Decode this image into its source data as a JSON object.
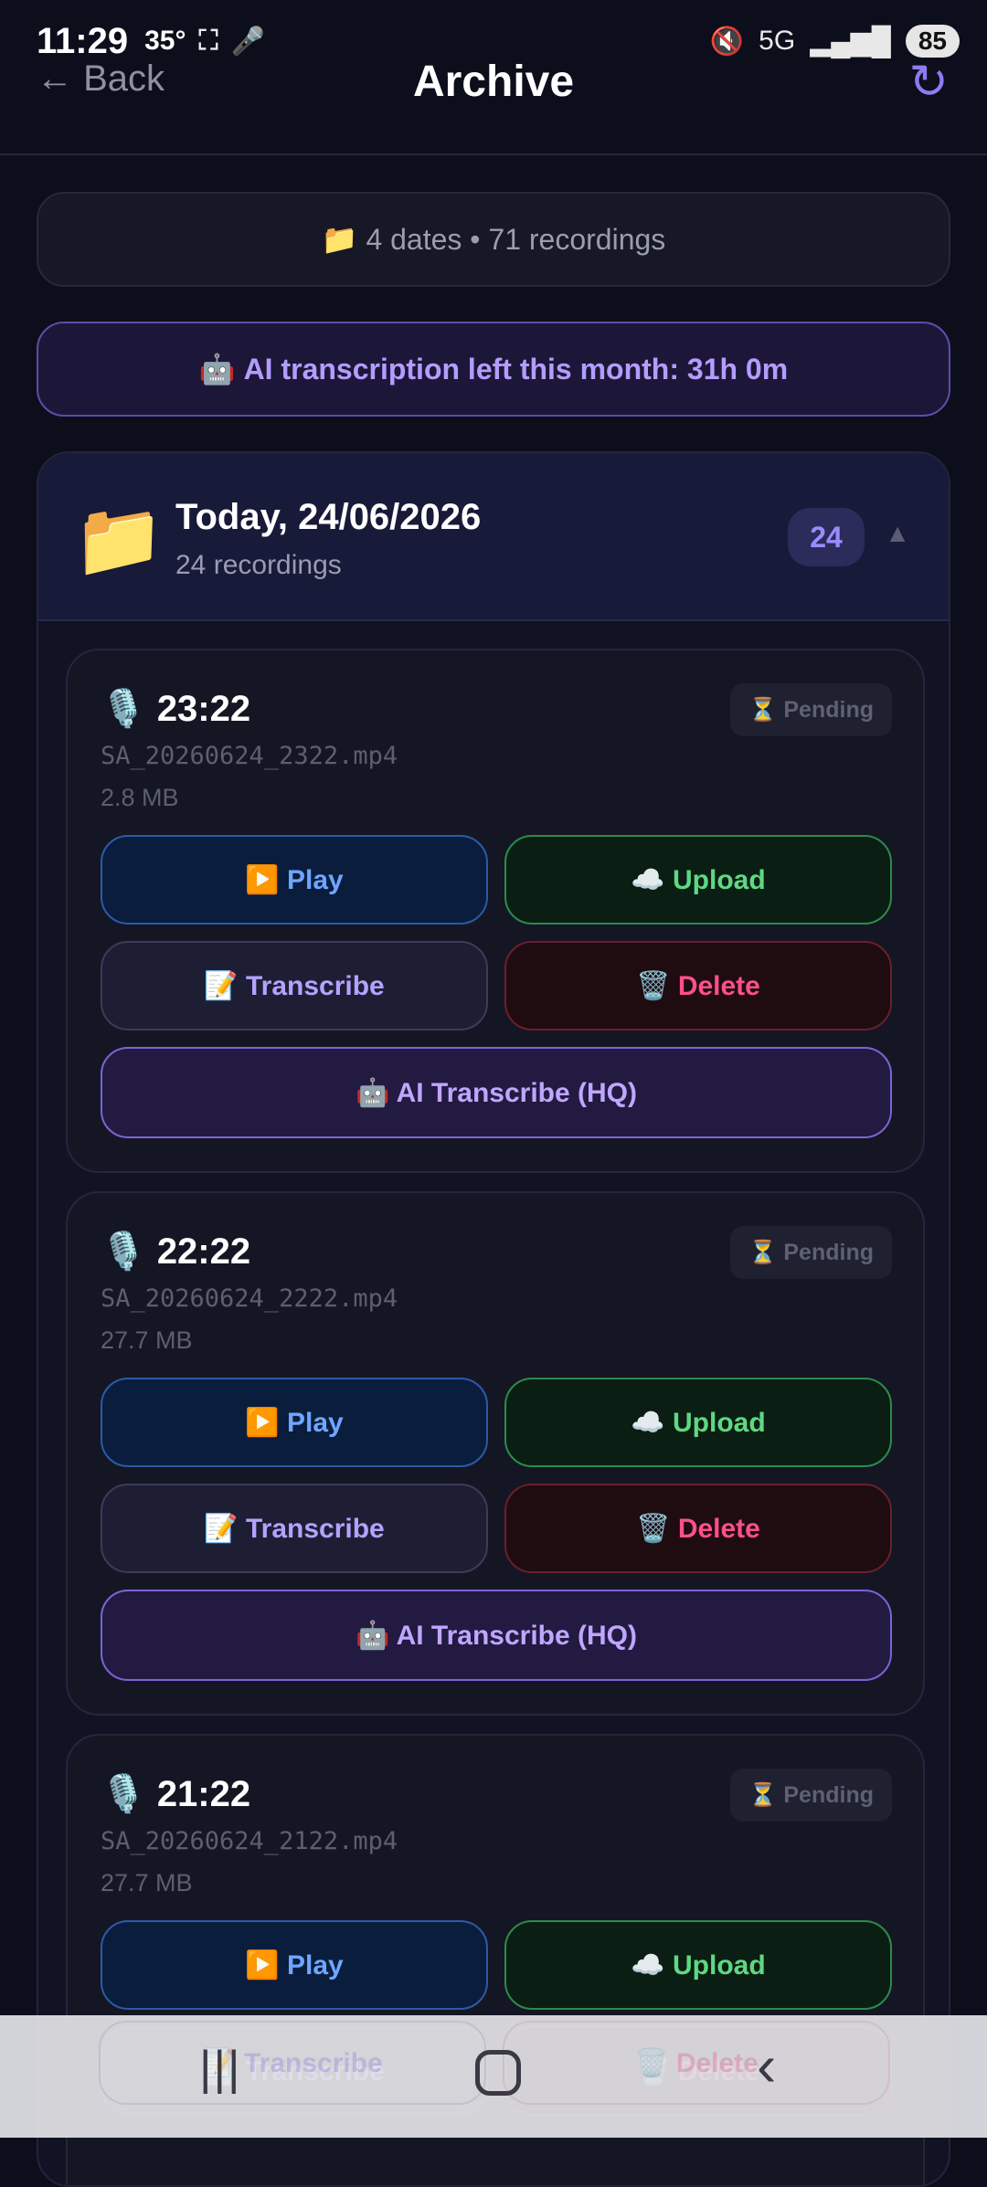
{
  "status_bar": {
    "time": "11:29",
    "temp": "35°",
    "battery": "85"
  },
  "header": {
    "back_label": "← Back",
    "title": "Archive",
    "refresh_glyph": "↻"
  },
  "summary": {
    "icon": "📁",
    "text": "4 dates • 71 recordings"
  },
  "ai_quota": {
    "icon": "🤖",
    "text": "AI transcription left this month: 31h 0m"
  },
  "group": {
    "icon": "📁",
    "title": "Today, 24/06/2026",
    "subtitle": "24 recordings",
    "count": "24",
    "collapse_glyph": "▲"
  },
  "cards": [
    {
      "time": "23:22",
      "file": "SA_20260624_2322.mp4",
      "size": "2.8 MB",
      "status": "⏳ Pending"
    },
    {
      "time": "22:22",
      "file": "SA_20260624_2222.mp4",
      "size": "27.7 MB",
      "status": "⏳ Pending"
    },
    {
      "time": "21:22",
      "file": "SA_20260624_2122.mp4",
      "size": "27.7 MB",
      "status": "⏳ Pending"
    }
  ],
  "buttons": {
    "play": "▶️ Play",
    "upload": "☁️ Upload",
    "transcribe": "📝 Transcribe",
    "delete": "🗑️ Delete",
    "ai": "🤖 AI Transcribe (HQ)"
  },
  "icons": {
    "mic": "🎙️",
    "nav_recents": "|||",
    "nav_back": "‹"
  },
  "colors": {
    "background": "#0d0e1b",
    "accent": "#8b7cf6",
    "play": "#6ea6ff",
    "upload": "#5fd882",
    "delete": "#ff4f8b"
  }
}
